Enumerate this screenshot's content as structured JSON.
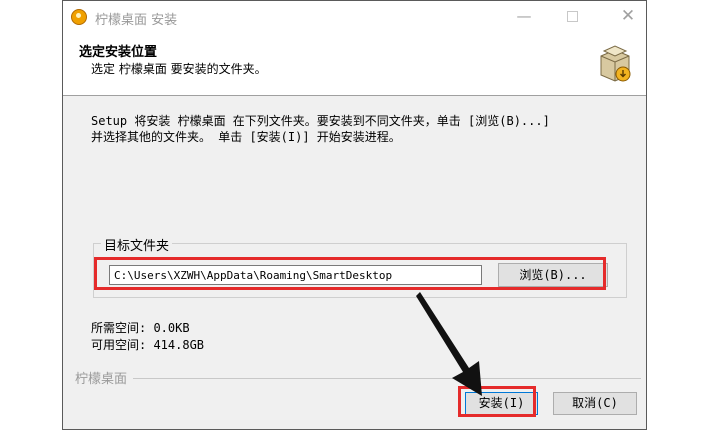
{
  "window": {
    "title": "柠檬桌面 安装",
    "minimize_glyph": "—",
    "close_glyph": "✕"
  },
  "header": {
    "title": "选定安装位置",
    "subtitle": "选定 柠檬桌面 要安装的文件夹。",
    "icon": "installer-box-icon"
  },
  "description": "Setup 将安装 柠檬桌面 在下列文件夹。要安装到不同文件夹，单击 [浏览(B)...]\n并选择其他的文件夹。 单击 [安装(I)] 开始安装进程。",
  "destination": {
    "group_label": "目标文件夹",
    "path_value": "C:\\Users\\XZWH\\AppData\\Roaming\\SmartDesktop",
    "browse_label": "浏览(B)..."
  },
  "space": {
    "required": "所需空间: 0.0KB",
    "available": "可用空间: 414.8GB"
  },
  "footer": {
    "brand": "柠檬桌面",
    "install_label": "安装(I)",
    "cancel_label": "取消(C)"
  },
  "annotations": {
    "highlight_color": "#e52b2b",
    "arrow_color": "#111111"
  }
}
